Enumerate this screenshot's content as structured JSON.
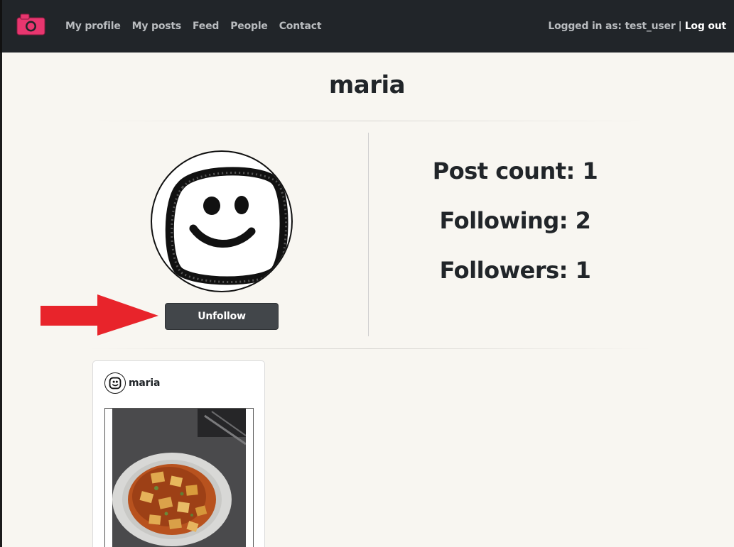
{
  "nav": {
    "logo": "camera-icon",
    "links": [
      "My profile",
      "My posts",
      "Feed",
      "People",
      "Contact"
    ],
    "logged_in_label": "Logged in as: test_user",
    "separator": "|",
    "logout_label": "Log out"
  },
  "profile": {
    "username": "maria",
    "avatar": "smiley-face-avatar",
    "unfollow_label": "Unfollow"
  },
  "stats": {
    "post_count": "Post count: 1",
    "following": "Following: 2",
    "followers": "Followers: 1"
  },
  "posts": [
    {
      "author": "maria",
      "image": "mapo-tofu-dish-photo"
    }
  ],
  "colors": {
    "navbar": "#212529",
    "logo": "#e8366f",
    "button": "#42464a",
    "arrow": "#e8242b",
    "background": "#f8f6f1"
  }
}
